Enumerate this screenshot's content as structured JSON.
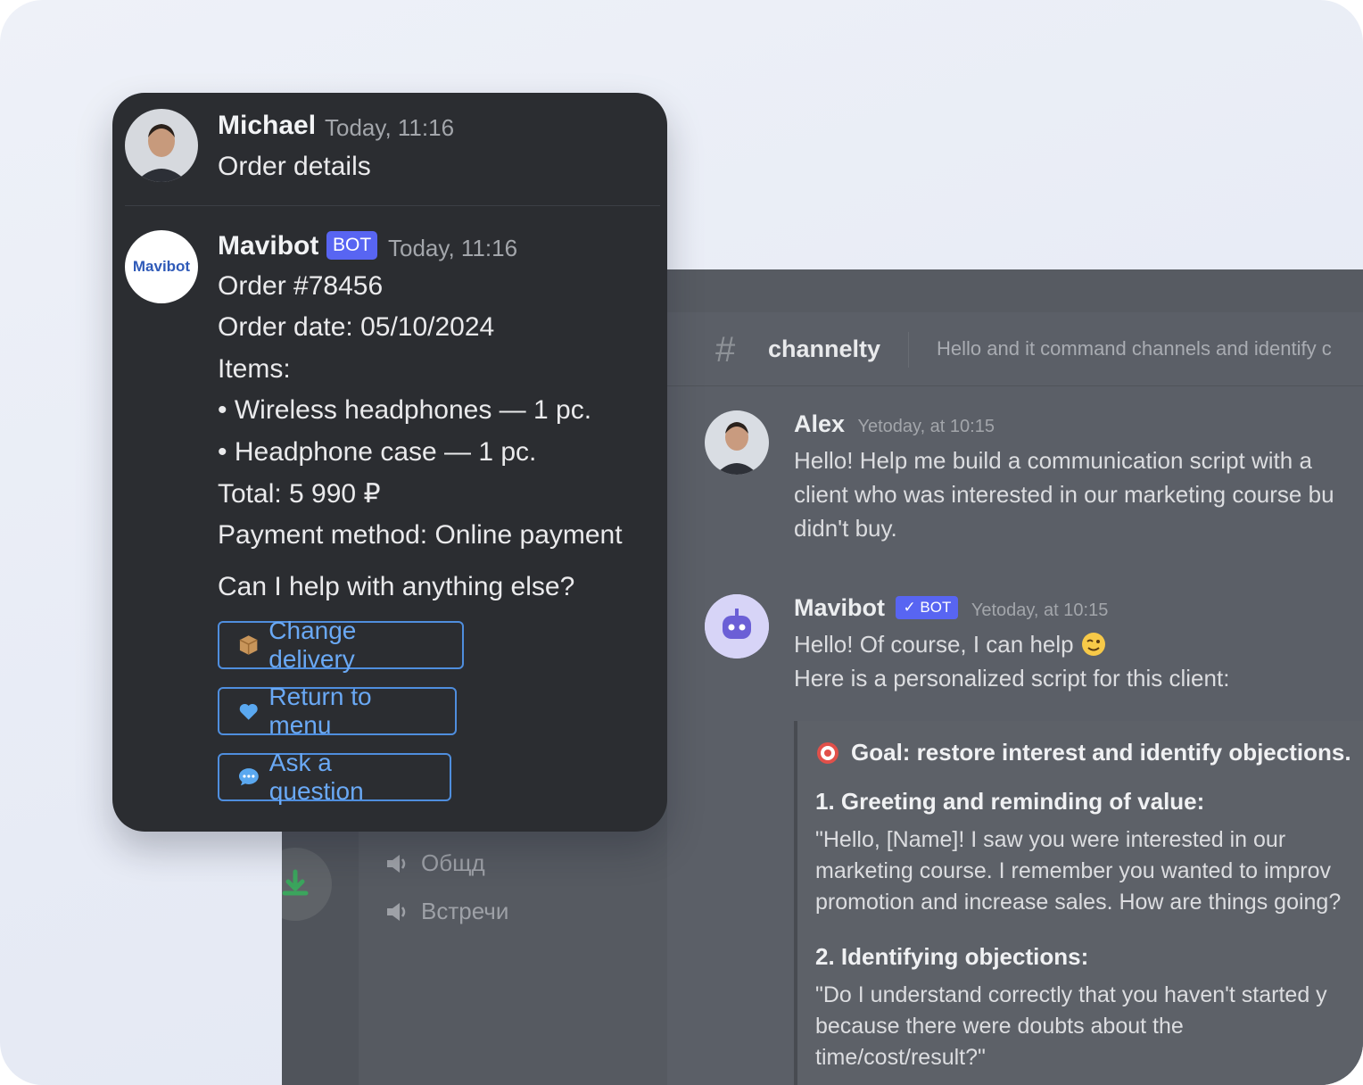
{
  "background_window": {
    "channel": {
      "name": "channelty",
      "topic": "Hello and it command channels and identify c"
    },
    "voice_channels": [
      "Общд",
      "Встречи"
    ],
    "messages": [
      {
        "author": "Alex",
        "time": "Yetoday, at 10:15",
        "lines": [
          "Hello! Help me build a communication script with a",
          "client who was interested in our marketing course bu",
          "didn't buy."
        ]
      },
      {
        "author": "Mavibot",
        "badge": "✓ BOT",
        "time": "Yetoday, at 10:15",
        "lines": [
          "Hello! Of course, I can help",
          "Here is a personalized script for this client:"
        ]
      }
    ],
    "embed": {
      "goal": "Goal: restore interest and identify objections.",
      "section1_title": "1. Greeting and reminding of value:",
      "section1_lines": [
        "\"Hello, [Name]! I saw you were interested in our",
        "marketing course. I remember you wanted to improv",
        "promotion and increase sales. How are things going?"
      ],
      "section2_title": "2. Identifying objections:",
      "section2_lines": [
        "\"Do I understand correctly that you haven't started y",
        "because there were doubts about the",
        "time/cost/result?\""
      ]
    }
  },
  "card": {
    "user_message": {
      "author": "Michael",
      "time": "Today, 11:16",
      "text": "Order details"
    },
    "bot_message": {
      "author": "Mavibot",
      "logo_text": "Mavibot",
      "badge": "BOT",
      "time": "Today, 11:16",
      "lines": [
        "Order #78456",
        "Order date: 05/10/2024",
        "Items:",
        "• Wireless headphones — 1 pc.",
        "• Headphone case — 1 pc.",
        "Total: 5 990 ₽",
        "Payment method: Online payment"
      ],
      "question": "Can I help with anything else?",
      "buttons": [
        {
          "label": "Change delivery",
          "icon": "package-icon"
        },
        {
          "label": "Return to menu",
          "icon": "heart-icon"
        },
        {
          "label": "Ask a question",
          "icon": "speech-bubble-icon"
        }
      ]
    }
  },
  "colors": {
    "accent": "#5865f2",
    "button_border": "#4f8ede",
    "card_bg": "#2b2d31",
    "bg_window": "#5b5f67"
  }
}
